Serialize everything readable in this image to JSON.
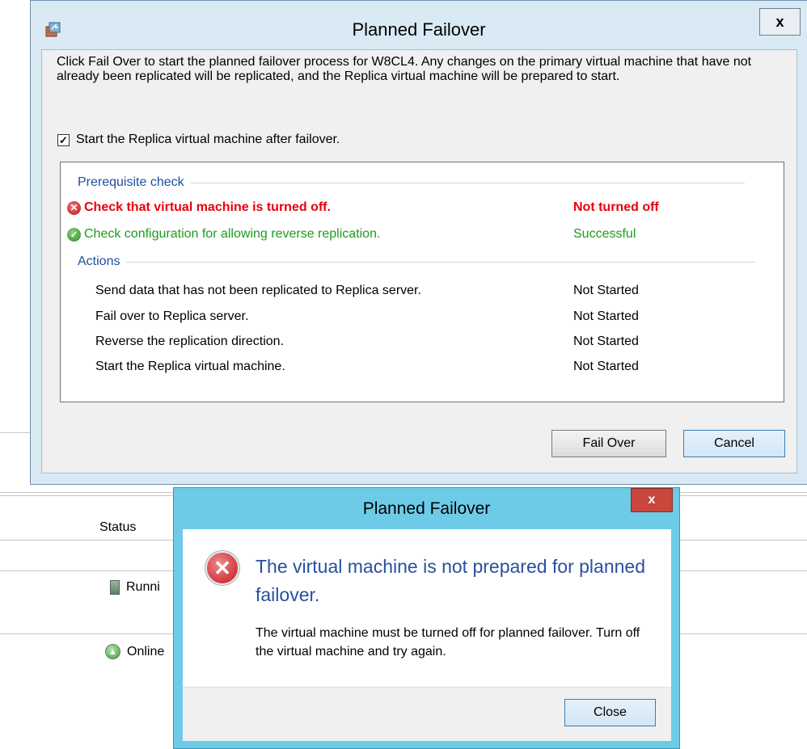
{
  "background": {
    "status_header": "Status",
    "rows": [
      {
        "text": "Runni",
        "icon": "vm-icon"
      },
      {
        "text": "Online",
        "icon": "online-icon"
      }
    ]
  },
  "main_dialog": {
    "title": "Planned Failover",
    "close_label": "x",
    "description": "Click Fail Over to start the planned failover process for W8CL4. Any changes on the primary virtual machine that have not already been replicated will be replicated, and the Replica virtual machine will be prepared to start.",
    "checkbox_label": "Start the Replica virtual machine after failover.",
    "checkbox_checked": true,
    "prerequisite_heading": "Prerequisite check",
    "prerequisites": [
      {
        "label": "Check that virtual machine is turned off.",
        "status": "Not turned off",
        "state": "error"
      },
      {
        "label": "Check configuration for allowing reverse replication.",
        "status": "Successful",
        "state": "ok"
      }
    ],
    "actions_heading": "Actions",
    "actions": [
      {
        "label": "Send data that has not been replicated to Replica server.",
        "status": "Not Started"
      },
      {
        "label": "Fail over to Replica server.",
        "status": "Not Started"
      },
      {
        "label": "Reverse the replication direction.",
        "status": "Not Started"
      },
      {
        "label": "Start the Replica virtual machine.",
        "status": "Not Started"
      }
    ],
    "fail_over_button": "Fail Over",
    "cancel_button": "Cancel"
  },
  "error_dialog": {
    "title": "Planned Failover",
    "close_label": "x",
    "heading": "The virtual machine is not prepared for planned failover.",
    "body": "The virtual machine must be turned off for planned failover. Turn off the virtual machine and try again.",
    "close_button": "Close"
  },
  "colors": {
    "error_text": "#e8000b",
    "success_text": "#1f9a1f",
    "section_heading": "#1e4fa3",
    "error_dialog_frame": "#6ecbe8",
    "main_dialog_frame": "#d9eaf5"
  }
}
